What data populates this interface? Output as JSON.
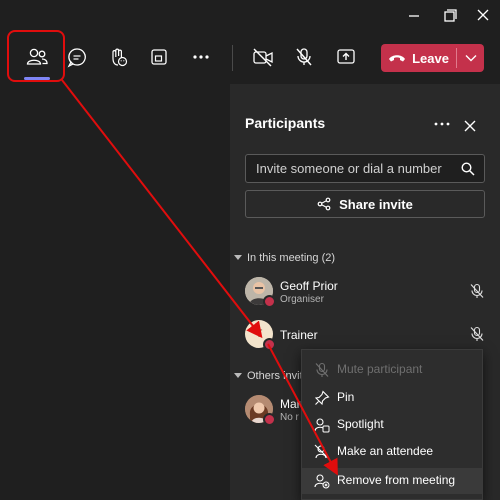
{
  "toolbar": {
    "leave_label": "Leave"
  },
  "panel": {
    "title": "Participants",
    "search_placeholder": "Invite someone or dial a number",
    "share_label": "Share invite",
    "section_in_meeting": "In this meeting (2)",
    "section_others": "Others invite",
    "participants": [
      {
        "name": "Geoff Prior",
        "role": "Organiser"
      },
      {
        "name": "Trainer",
        "initial": "T"
      },
      {
        "name": "Mar",
        "role": "No r"
      }
    ]
  },
  "menu": {
    "items": [
      {
        "label": "Mute participant",
        "icon": "mic-off-icon",
        "enabled": false
      },
      {
        "label": "Pin",
        "icon": "pin-icon",
        "enabled": true
      },
      {
        "label": "Spotlight",
        "icon": "spotlight-icon",
        "enabled": true
      },
      {
        "label": "Make an attendee",
        "icon": "make-attendee-icon",
        "enabled": true
      },
      {
        "label": "Remove from meeting",
        "icon": "remove-person-icon",
        "enabled": true
      }
    ]
  },
  "colors": {
    "background": "#1f1f1f",
    "panel": "#292929",
    "leave": "#c4314b",
    "accent": "#7f85f5",
    "annotation": "#e00d0d"
  }
}
